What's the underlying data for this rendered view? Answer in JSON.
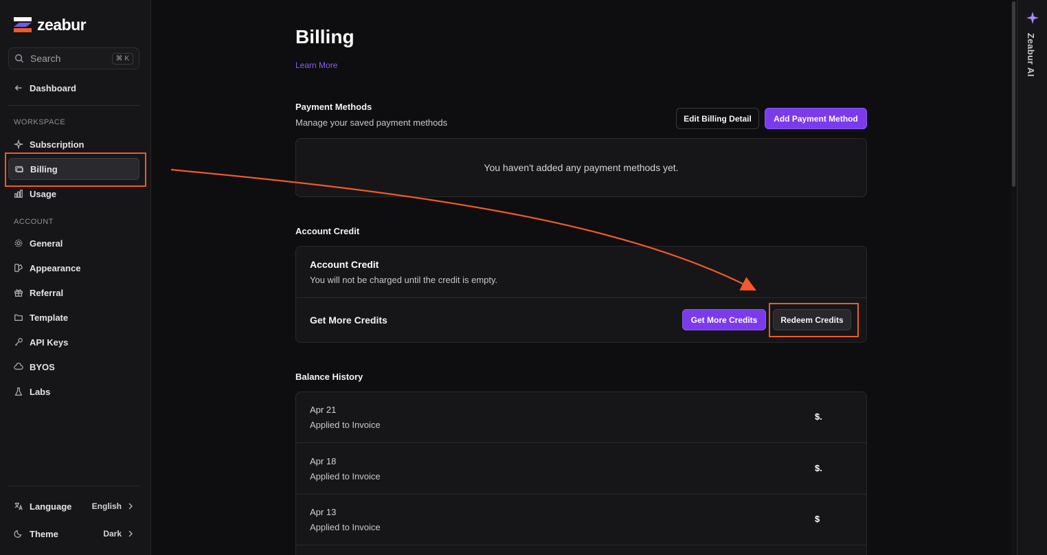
{
  "brand": {
    "name": "zeabur"
  },
  "sidebar": {
    "search": {
      "placeholder": "Search",
      "shortcut": "⌘ K"
    },
    "back": {
      "label": "Dashboard"
    },
    "workspace_label": "WORKSPACE",
    "workspace_items": [
      {
        "label": "Subscription",
        "icon": "sparkle-icon"
      },
      {
        "label": "Billing",
        "icon": "credit-card-icon",
        "active": true
      },
      {
        "label": "Usage",
        "icon": "bar-chart-icon"
      }
    ],
    "account_label": "ACCOUNT",
    "account_items": [
      {
        "label": "General",
        "icon": "gear-icon"
      },
      {
        "label": "Appearance",
        "icon": "palette-icon"
      },
      {
        "label": "Referral",
        "icon": "gift-icon"
      },
      {
        "label": "Template",
        "icon": "folder-icon"
      },
      {
        "label": "API Keys",
        "icon": "key-icon"
      },
      {
        "label": "BYOS",
        "icon": "server-icon"
      },
      {
        "label": "Labs",
        "icon": "flask-icon"
      }
    ],
    "footer": {
      "language": {
        "label": "Language",
        "value": "English"
      },
      "theme": {
        "label": "Theme",
        "value": "Dark"
      }
    }
  },
  "page": {
    "title": "Billing",
    "learn_more": "Learn More",
    "payment": {
      "title": "Payment Methods",
      "subtitle": "Manage your saved payment methods",
      "edit_button": "Edit Billing Detail",
      "add_button": "Add Payment Method",
      "empty": "You haven't added any payment methods yet."
    },
    "credit": {
      "section_title": "Account Credit",
      "card_title": "Account Credit",
      "card_subtitle": "You will not be charged until the credit is empty.",
      "more_label": "Get More Credits",
      "get_button": "Get More Credits",
      "redeem_button": "Redeem Credits"
    },
    "history": {
      "title": "Balance History",
      "rows": [
        {
          "date": "Apr 21",
          "desc": "Applied to Invoice",
          "amount": "$."
        },
        {
          "date": "Apr 18",
          "desc": "Applied to Invoice",
          "amount": "$."
        },
        {
          "date": "Apr 13",
          "desc": "Applied to Invoice",
          "amount": "$"
        }
      ]
    }
  },
  "ai_panel": {
    "label": "Zeabur AI"
  },
  "colors": {
    "accent": "#7c3aed",
    "annotation": "#f05a28"
  }
}
